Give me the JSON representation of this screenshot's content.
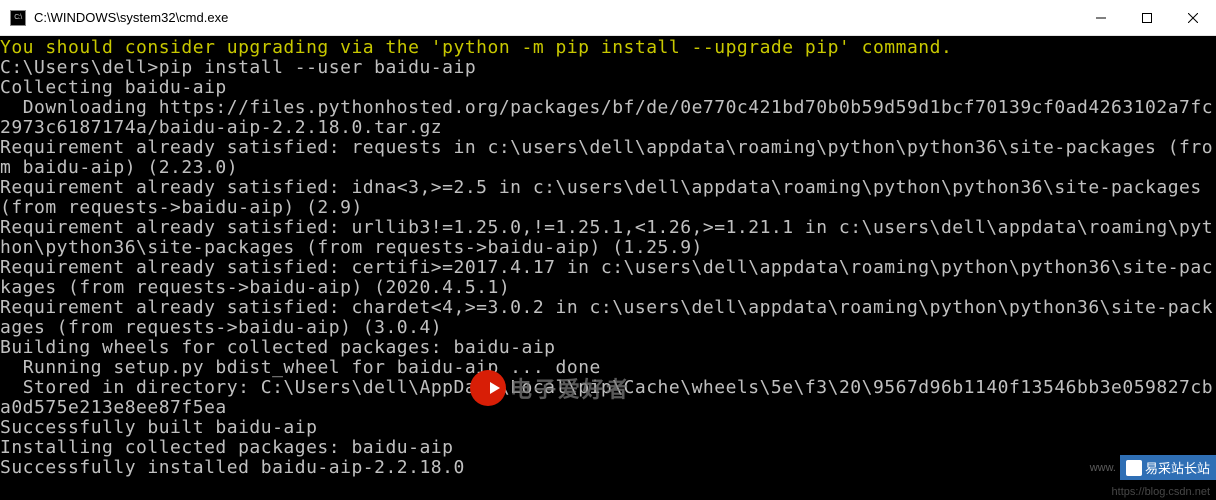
{
  "titlebar": {
    "icon_label": "C:\\",
    "title": "C:\\WINDOWS\\system32\\cmd.exe"
  },
  "terminal": {
    "lines": [
      {
        "cls": "yellow",
        "t": "You should consider upgrading via the 'python -m pip install --upgrade pip' command."
      },
      {
        "cls": "",
        "t": ""
      },
      {
        "cls": "",
        "t": "C:\\Users\\dell>pip install --user baidu-aip"
      },
      {
        "cls": "",
        "t": "Collecting baidu-aip"
      },
      {
        "cls": "",
        "t": "  Downloading https://files.pythonhosted.org/packages/bf/de/0e770c421bd70b0b59d59d1bcf70139cf0ad4263102a7fc2973c6187174a/baidu-aip-2.2.18.0.tar.gz"
      },
      {
        "cls": "",
        "t": "Requirement already satisfied: requests in c:\\users\\dell\\appdata\\roaming\\python\\python36\\site-packages (from baidu-aip) (2.23.0)"
      },
      {
        "cls": "",
        "t": "Requirement already satisfied: idna<3,>=2.5 in c:\\users\\dell\\appdata\\roaming\\python\\python36\\site-packages (from requests->baidu-aip) (2.9)"
      },
      {
        "cls": "",
        "t": "Requirement already satisfied: urllib3!=1.25.0,!=1.25.1,<1.26,>=1.21.1 in c:\\users\\dell\\appdata\\roaming\\python\\python36\\site-packages (from requests->baidu-aip) (1.25.9)"
      },
      {
        "cls": "",
        "t": "Requirement already satisfied: certifi>=2017.4.17 in c:\\users\\dell\\appdata\\roaming\\python\\python36\\site-packages (from requests->baidu-aip) (2020.4.5.1)"
      },
      {
        "cls": "",
        "t": "Requirement already satisfied: chardet<4,>=3.0.2 in c:\\users\\dell\\appdata\\roaming\\python\\python36\\site-packages (from requests->baidu-aip) (3.0.4)"
      },
      {
        "cls": "",
        "t": "Building wheels for collected packages: baidu-aip"
      },
      {
        "cls": "",
        "t": "  Running setup.py bdist_wheel for baidu-aip ... done"
      },
      {
        "cls": "",
        "t": "  Stored in directory: C:\\Users\\dell\\AppData\\Local\\pip\\Cache\\wheels\\5e\\f3\\20\\9567d96b1140f13546bb3e059827cba0d575e213e8ee87f5ea"
      },
      {
        "cls": "",
        "t": "Successfully built baidu-aip"
      },
      {
        "cls": "",
        "t": "Installing collected packages: baidu-aip"
      },
      {
        "cls": "",
        "t": "Successfully installed baidu-aip-2.2.18.0"
      }
    ]
  },
  "watermarks": {
    "center_text": "电子爱好者",
    "br_host": "www.",
    "br_badge": "易采站长站",
    "csdn": "https://blog.csdn.net"
  }
}
